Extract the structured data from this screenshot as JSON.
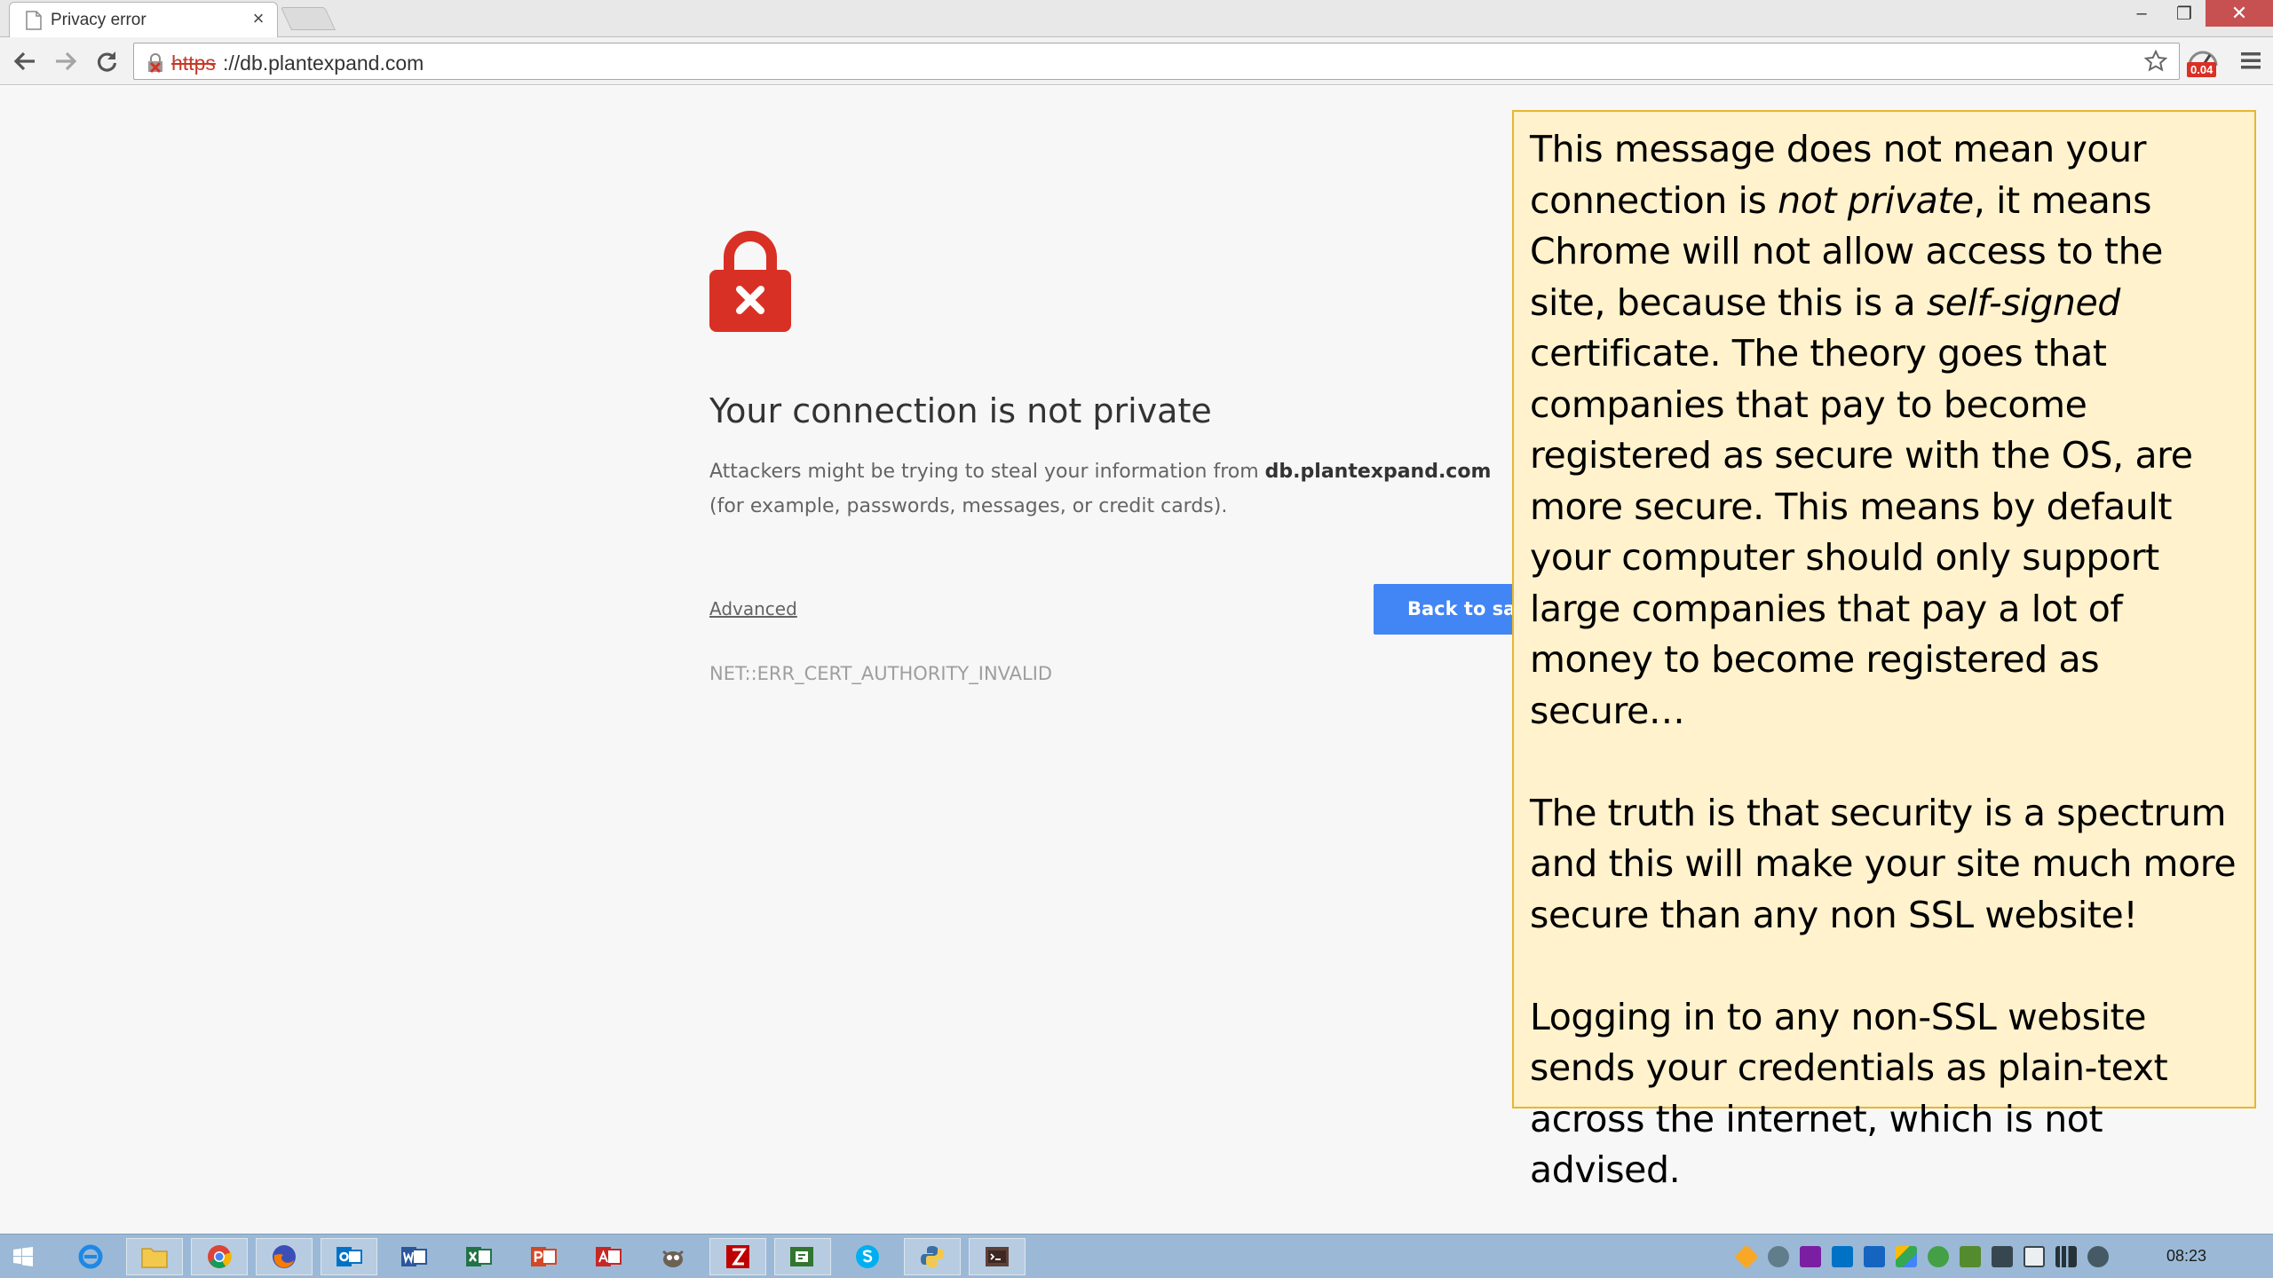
{
  "browser": {
    "tab_title": "Privacy error",
    "tab_close": "×",
    "url_scheme": "https",
    "url_rest": "://db.plantexpand.com",
    "extension_badge": "0.04"
  },
  "window_controls": {
    "minimize": "–",
    "restore": "❐",
    "close": "✕"
  },
  "interstitial": {
    "heading": "Your connection is not private",
    "para_prefix": "Attackers might be trying to steal your information from ",
    "para_domain": "db.plantexpand.com",
    "para_suffix": " (for example, passwords, messages, or credit cards).",
    "advanced_label": "Advanced",
    "back_button_label": "Back to safety",
    "error_code": "NET::ERR_CERT_AUTHORITY_INVALID"
  },
  "note": {
    "p1_a": "This message does not mean your connection is ",
    "p1_em1": "not private",
    "p1_b": ", it means Chrome will not allow access to the site, because this is a ",
    "p1_em2": "self-signed",
    "p1_c": " certificate. The theory goes that companies that pay to become registered as secure with the OS, are more secure. This means by default your computer should only support large companies that pay a lot of money to become registered as secure…",
    "p2": "The truth is that security is a spectrum and this will make your site much more secure than any non SSL website!",
    "p3": "Logging in to any non-SSL website sends your credentials as plain-text across the internet, which is not advised."
  },
  "taskbar": {
    "apps": [
      "windows-start",
      "internet-explorer",
      "file-explorer",
      "chrome",
      "firefox",
      "outlook",
      "word",
      "excel",
      "powerpoint",
      "acrobat",
      "gimp",
      "filezilla",
      "project",
      "skype",
      "python",
      "terminal"
    ],
    "clock": "08:23"
  },
  "colors": {
    "accent_blue": "#4285f4",
    "lock_red": "#d93025",
    "note_bg": "#fff2cc",
    "note_border": "#e6b730",
    "taskbar": "#9bb9d6"
  }
}
